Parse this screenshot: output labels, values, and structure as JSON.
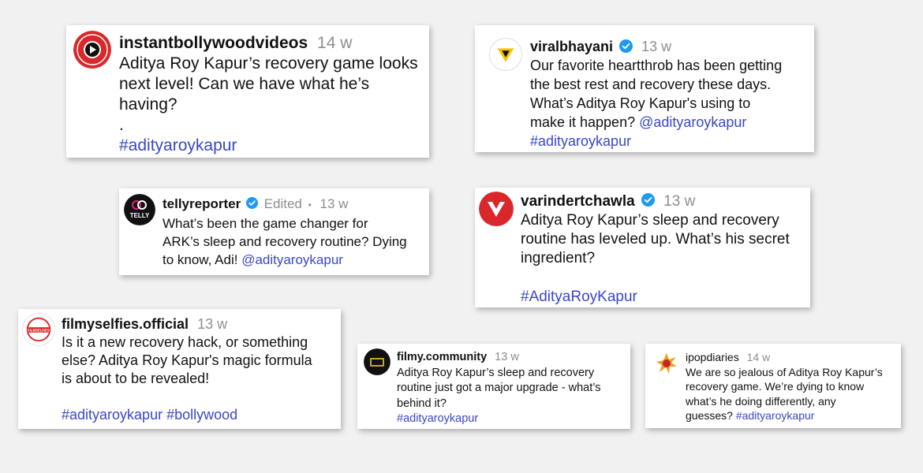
{
  "brand": {
    "link_color": "#3a46c9",
    "verified_color": "#1d9bf0",
    "meta_color": "#8e8e8e"
  },
  "comments": [
    {
      "user": "instantbollywoodvideos",
      "time": "14 w",
      "avatar_icon": "instant-bollywood-logo",
      "lines": [
        "Aditya Roy Kapur’s recovery game looks",
        "next level! Can we have what he’s",
        "having?",
        ".",
        "#adityaroykapur"
      ]
    },
    {
      "user": "viralbhayani",
      "verified": true,
      "time": "13 w",
      "avatar_icon": "viral-bhayani-logo",
      "lines": [
        "Our favorite heartthrob has been getting",
        "the best rest and recovery these days.",
        "What’s Aditya Roy Kapur's using to",
        "make it happen? ",
        "@adityaroykapur",
        "#adityaroykapur"
      ]
    },
    {
      "user": "tellyreporter",
      "verified": true,
      "edited": "Edited",
      "dot": "•",
      "time": "13 w",
      "avatar_icon": "telly-reporter-logo",
      "avatar_text": "TELLY",
      "lines": [
        "What’s been the game changer for",
        "ARK’s sleep and recovery routine? Dying",
        "to know, Adi! ",
        "@adityaroykapur"
      ]
    },
    {
      "user": "varindertchawla",
      "verified": true,
      "time": "13 w",
      "avatar_icon": "varinder-chawla-logo",
      "lines": [
        "Aditya Roy Kapur’s sleep and recovery",
        "routine has leveled up. What’s his secret",
        "ingredient?",
        "#AdityaRoyKapur"
      ]
    },
    {
      "user": "filmyselfies.official",
      "time": "13 w",
      "avatar_icon": "filmy-selfies-logo",
      "avatar_text": "FILMSELFIES",
      "lines": [
        "Is it a new recovery hack, or something",
        "else? Aditya Roy Kapur's magic formula",
        "is about to be revealed!",
        "#adityaroykapur #bollywood"
      ]
    },
    {
      "user": "filmy.community",
      "time": "13 w",
      "avatar_icon": "filmy-community-logo",
      "lines": [
        "Aditya Roy Kapur’s sleep and recovery",
        "routine just got a major upgrade - what’s",
        "behind it?",
        "#adityaroykapur"
      ]
    },
    {
      "user": "ipopdiaries",
      "time": "14 w",
      "avatar_icon": "ipop-diaries-logo",
      "lines": [
        "We are so jealous of Aditya Roy Kapur’s",
        "recovery game. We’re dying to know",
        "what’s he doing differently, any",
        "guesses? ",
        "#adityaroykapur"
      ]
    }
  ]
}
